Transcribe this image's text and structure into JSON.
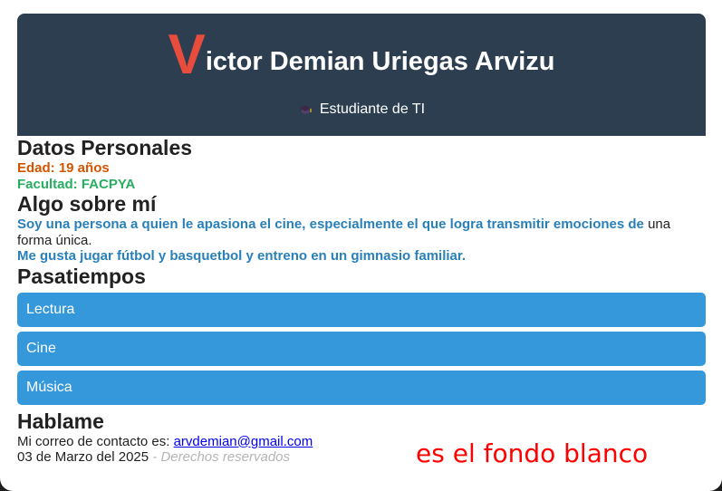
{
  "header": {
    "name_initial": "V",
    "name_rest": "ictor Demian Uriegas Arvizu",
    "subtitle": "Estudiante de TI",
    "subtitle_icon": "graduation-cap-icon"
  },
  "personal": {
    "title": "Datos Personales",
    "age": "Edad: 19 años",
    "faculty": "Facultad: FACPYA"
  },
  "about": {
    "title": "Algo sobre mí",
    "line1_bold": "Soy una persona a quien le apasiona el cine, especialmente el que logra transmitir emociones de",
    "line1_rest": "una forma única.",
    "line2": "Me gusta jugar fútbol y basquetbol y entreno en un gimnasio familiar."
  },
  "hobbies": {
    "title": "Pasatiempos",
    "items": [
      "Lectura",
      "Cine",
      "Música"
    ]
  },
  "contact": {
    "title": "Hablame",
    "email_prefix": "Mi correo de contacto es: ",
    "email": "arvdemian@gmail.com",
    "date": "03 de Marzo del 2025",
    "separator": " - ",
    "rights": "Derechos reservados"
  },
  "annotation": "es el fondo blanco",
  "colors": {
    "header_bg": "#2c3e50",
    "initial": "#e74c3c",
    "age": "#d35400",
    "faculty": "#27ae60",
    "about": "#2980b9",
    "hobby_bg": "#3498db",
    "annotation": "#ff0000"
  }
}
